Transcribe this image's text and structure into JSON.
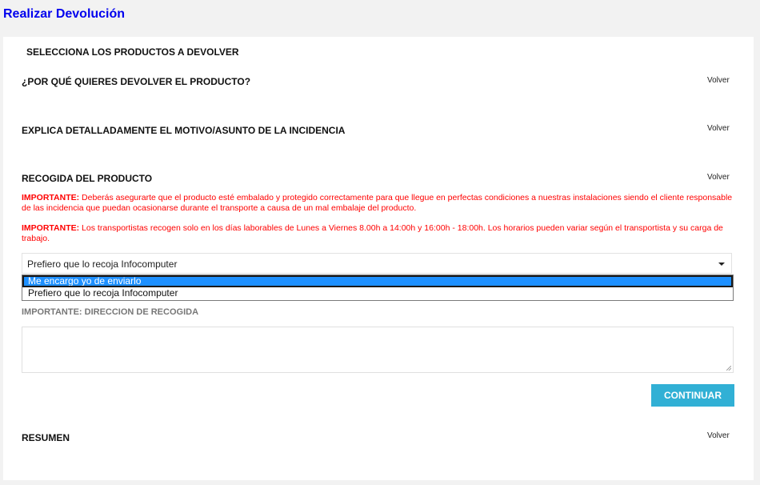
{
  "page": {
    "title": "Realizar Devolución"
  },
  "sections": {
    "select_products": {
      "title": "SELECCIONA LOS PRODUCTOS A DEVOLVER"
    },
    "why_return": {
      "title": "¿POR QUÉ QUIERES DEVOLVER EL PRODUCTO?",
      "back": "Volver"
    },
    "explain": {
      "title": "EXPLICA DETALLADAMENTE EL MOTIVO/ASUNTO DE LA INCIDENCIA",
      "back": "Volver"
    },
    "pickup": {
      "title": "RECOGIDA DEL PRODUCTO",
      "back": "Volver",
      "notice1_label": "IMPORTANTE:",
      "notice1_text": " Deberás asegurarte que el producto esté embalado y protegido correctamente para que llegue en perfectas condiciones a nuestras instalaciones siendo el cliente responsable de las incidencia que puedan ocasionarse durante el transporte a causa de un mal embalaje del producto.",
      "notice2_label": "IMPORTANTE:",
      "notice2_text": " Los transportistas recogen solo en los días laborables de Lunes a Viernes 8.00h a 14:00h y 16:00h - 18:00h. Los horarios pueden variar según el transportista y su carga de trabajo.",
      "select_value": "Prefiero que lo recoja Infocomputer",
      "options": [
        "Me encargo yo de enviarlo",
        "Prefiero que lo recoja Infocomputer"
      ],
      "address_label": "IMPORTANTE: DIRECCION DE RECOGIDA",
      "address_value": "",
      "continue_label": "CONTINUAR"
    },
    "summary": {
      "title": "RESUMEN",
      "back": "Volver"
    }
  },
  "colors": {
    "title": "#0000ee",
    "notice": "#ff0000",
    "button": "#31b0d5",
    "highlight": "#1e90ff"
  }
}
